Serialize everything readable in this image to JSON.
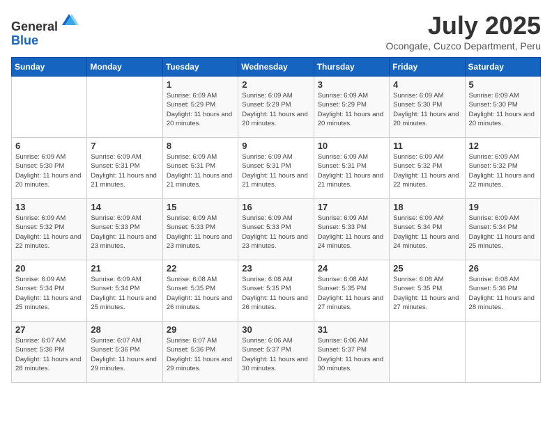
{
  "header": {
    "logo_general": "General",
    "logo_blue": "Blue",
    "title": "July 2025",
    "location": "Ocongate, Cuzco Department, Peru"
  },
  "weekdays": [
    "Sunday",
    "Monday",
    "Tuesday",
    "Wednesday",
    "Thursday",
    "Friday",
    "Saturday"
  ],
  "weeks": [
    [
      {
        "day": "",
        "info": ""
      },
      {
        "day": "",
        "info": ""
      },
      {
        "day": "1",
        "info": "Sunrise: 6:09 AM\nSunset: 5:29 PM\nDaylight: 11 hours and 20 minutes."
      },
      {
        "day": "2",
        "info": "Sunrise: 6:09 AM\nSunset: 5:29 PM\nDaylight: 11 hours and 20 minutes."
      },
      {
        "day": "3",
        "info": "Sunrise: 6:09 AM\nSunset: 5:29 PM\nDaylight: 11 hours and 20 minutes."
      },
      {
        "day": "4",
        "info": "Sunrise: 6:09 AM\nSunset: 5:30 PM\nDaylight: 11 hours and 20 minutes."
      },
      {
        "day": "5",
        "info": "Sunrise: 6:09 AM\nSunset: 5:30 PM\nDaylight: 11 hours and 20 minutes."
      }
    ],
    [
      {
        "day": "6",
        "info": "Sunrise: 6:09 AM\nSunset: 5:30 PM\nDaylight: 11 hours and 20 minutes."
      },
      {
        "day": "7",
        "info": "Sunrise: 6:09 AM\nSunset: 5:31 PM\nDaylight: 11 hours and 21 minutes."
      },
      {
        "day": "8",
        "info": "Sunrise: 6:09 AM\nSunset: 5:31 PM\nDaylight: 11 hours and 21 minutes."
      },
      {
        "day": "9",
        "info": "Sunrise: 6:09 AM\nSunset: 5:31 PM\nDaylight: 11 hours and 21 minutes."
      },
      {
        "day": "10",
        "info": "Sunrise: 6:09 AM\nSunset: 5:31 PM\nDaylight: 11 hours and 21 minutes."
      },
      {
        "day": "11",
        "info": "Sunrise: 6:09 AM\nSunset: 5:32 PM\nDaylight: 11 hours and 22 minutes."
      },
      {
        "day": "12",
        "info": "Sunrise: 6:09 AM\nSunset: 5:32 PM\nDaylight: 11 hours and 22 minutes."
      }
    ],
    [
      {
        "day": "13",
        "info": "Sunrise: 6:09 AM\nSunset: 5:32 PM\nDaylight: 11 hours and 22 minutes."
      },
      {
        "day": "14",
        "info": "Sunrise: 6:09 AM\nSunset: 5:33 PM\nDaylight: 11 hours and 23 minutes."
      },
      {
        "day": "15",
        "info": "Sunrise: 6:09 AM\nSunset: 5:33 PM\nDaylight: 11 hours and 23 minutes."
      },
      {
        "day": "16",
        "info": "Sunrise: 6:09 AM\nSunset: 5:33 PM\nDaylight: 11 hours and 23 minutes."
      },
      {
        "day": "17",
        "info": "Sunrise: 6:09 AM\nSunset: 5:33 PM\nDaylight: 11 hours and 24 minutes."
      },
      {
        "day": "18",
        "info": "Sunrise: 6:09 AM\nSunset: 5:34 PM\nDaylight: 11 hours and 24 minutes."
      },
      {
        "day": "19",
        "info": "Sunrise: 6:09 AM\nSunset: 5:34 PM\nDaylight: 11 hours and 25 minutes."
      }
    ],
    [
      {
        "day": "20",
        "info": "Sunrise: 6:09 AM\nSunset: 5:34 PM\nDaylight: 11 hours and 25 minutes."
      },
      {
        "day": "21",
        "info": "Sunrise: 6:09 AM\nSunset: 5:34 PM\nDaylight: 11 hours and 25 minutes."
      },
      {
        "day": "22",
        "info": "Sunrise: 6:08 AM\nSunset: 5:35 PM\nDaylight: 11 hours and 26 minutes."
      },
      {
        "day": "23",
        "info": "Sunrise: 6:08 AM\nSunset: 5:35 PM\nDaylight: 11 hours and 26 minutes."
      },
      {
        "day": "24",
        "info": "Sunrise: 6:08 AM\nSunset: 5:35 PM\nDaylight: 11 hours and 27 minutes."
      },
      {
        "day": "25",
        "info": "Sunrise: 6:08 AM\nSunset: 5:35 PM\nDaylight: 11 hours and 27 minutes."
      },
      {
        "day": "26",
        "info": "Sunrise: 6:08 AM\nSunset: 5:36 PM\nDaylight: 11 hours and 28 minutes."
      }
    ],
    [
      {
        "day": "27",
        "info": "Sunrise: 6:07 AM\nSunset: 5:36 PM\nDaylight: 11 hours and 28 minutes."
      },
      {
        "day": "28",
        "info": "Sunrise: 6:07 AM\nSunset: 5:36 PM\nDaylight: 11 hours and 29 minutes."
      },
      {
        "day": "29",
        "info": "Sunrise: 6:07 AM\nSunset: 5:36 PM\nDaylight: 11 hours and 29 minutes."
      },
      {
        "day": "30",
        "info": "Sunrise: 6:06 AM\nSunset: 5:37 PM\nDaylight: 11 hours and 30 minutes."
      },
      {
        "day": "31",
        "info": "Sunrise: 6:06 AM\nSunset: 5:37 PM\nDaylight: 11 hours and 30 minutes."
      },
      {
        "day": "",
        "info": ""
      },
      {
        "day": "",
        "info": ""
      }
    ]
  ]
}
